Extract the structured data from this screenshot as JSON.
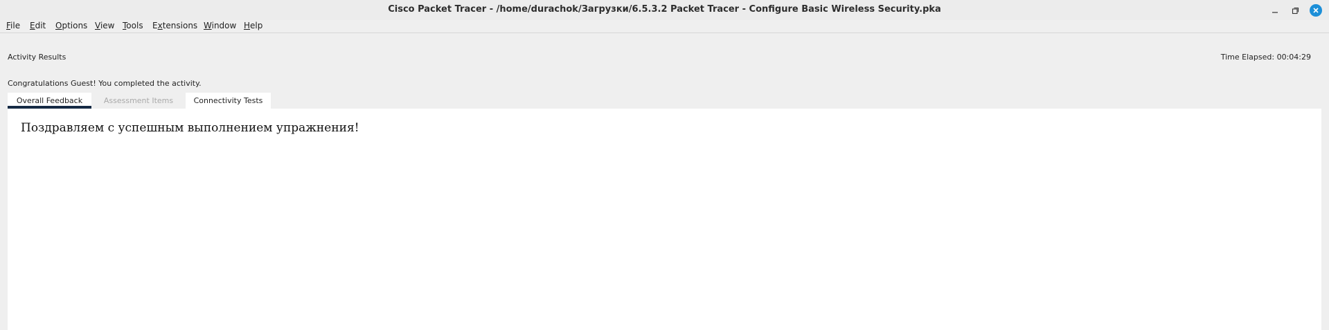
{
  "window": {
    "title": "Cisco Packet Tracer - /home/durachok/Загрузки/6.5.3.2 Packet Tracer - Configure Basic Wireless Security.pka"
  },
  "menu": {
    "items": [
      {
        "mnemonic": "F",
        "rest": "ile"
      },
      {
        "mnemonic": "E",
        "rest": "dit"
      },
      {
        "mnemonic": "O",
        "rest": "ptions"
      },
      {
        "mnemonic": "V",
        "rest": "iew"
      },
      {
        "mnemonic": "T",
        "rest": "ools"
      },
      {
        "pre": "E",
        "mnemonic": "x",
        "rest": "tensions"
      },
      {
        "mnemonic": "W",
        "rest": "indow"
      },
      {
        "mnemonic": "H",
        "rest": "elp"
      }
    ]
  },
  "activity": {
    "heading": "Activity Results",
    "time_elapsed_label": "Time Elapsed: ",
    "time_elapsed_value": "00:04:29",
    "congrats": "Congratulations Guest! You completed the activity."
  },
  "tabs": [
    {
      "label": "Overall Feedback",
      "state": "active"
    },
    {
      "label": "Assessment Items",
      "state": "disabled"
    },
    {
      "label": "Connectivity Tests",
      "state": "normal"
    }
  ],
  "feedback": {
    "text": "Поздравляем с успешным выполнением упражнения!"
  },
  "colors": {
    "accent": "#1c8fd8",
    "active_tab_underline": "#152a44"
  },
  "icons": {
    "minimize": "minimize-icon",
    "maximize": "maximize-icon",
    "close": "close-icon"
  }
}
